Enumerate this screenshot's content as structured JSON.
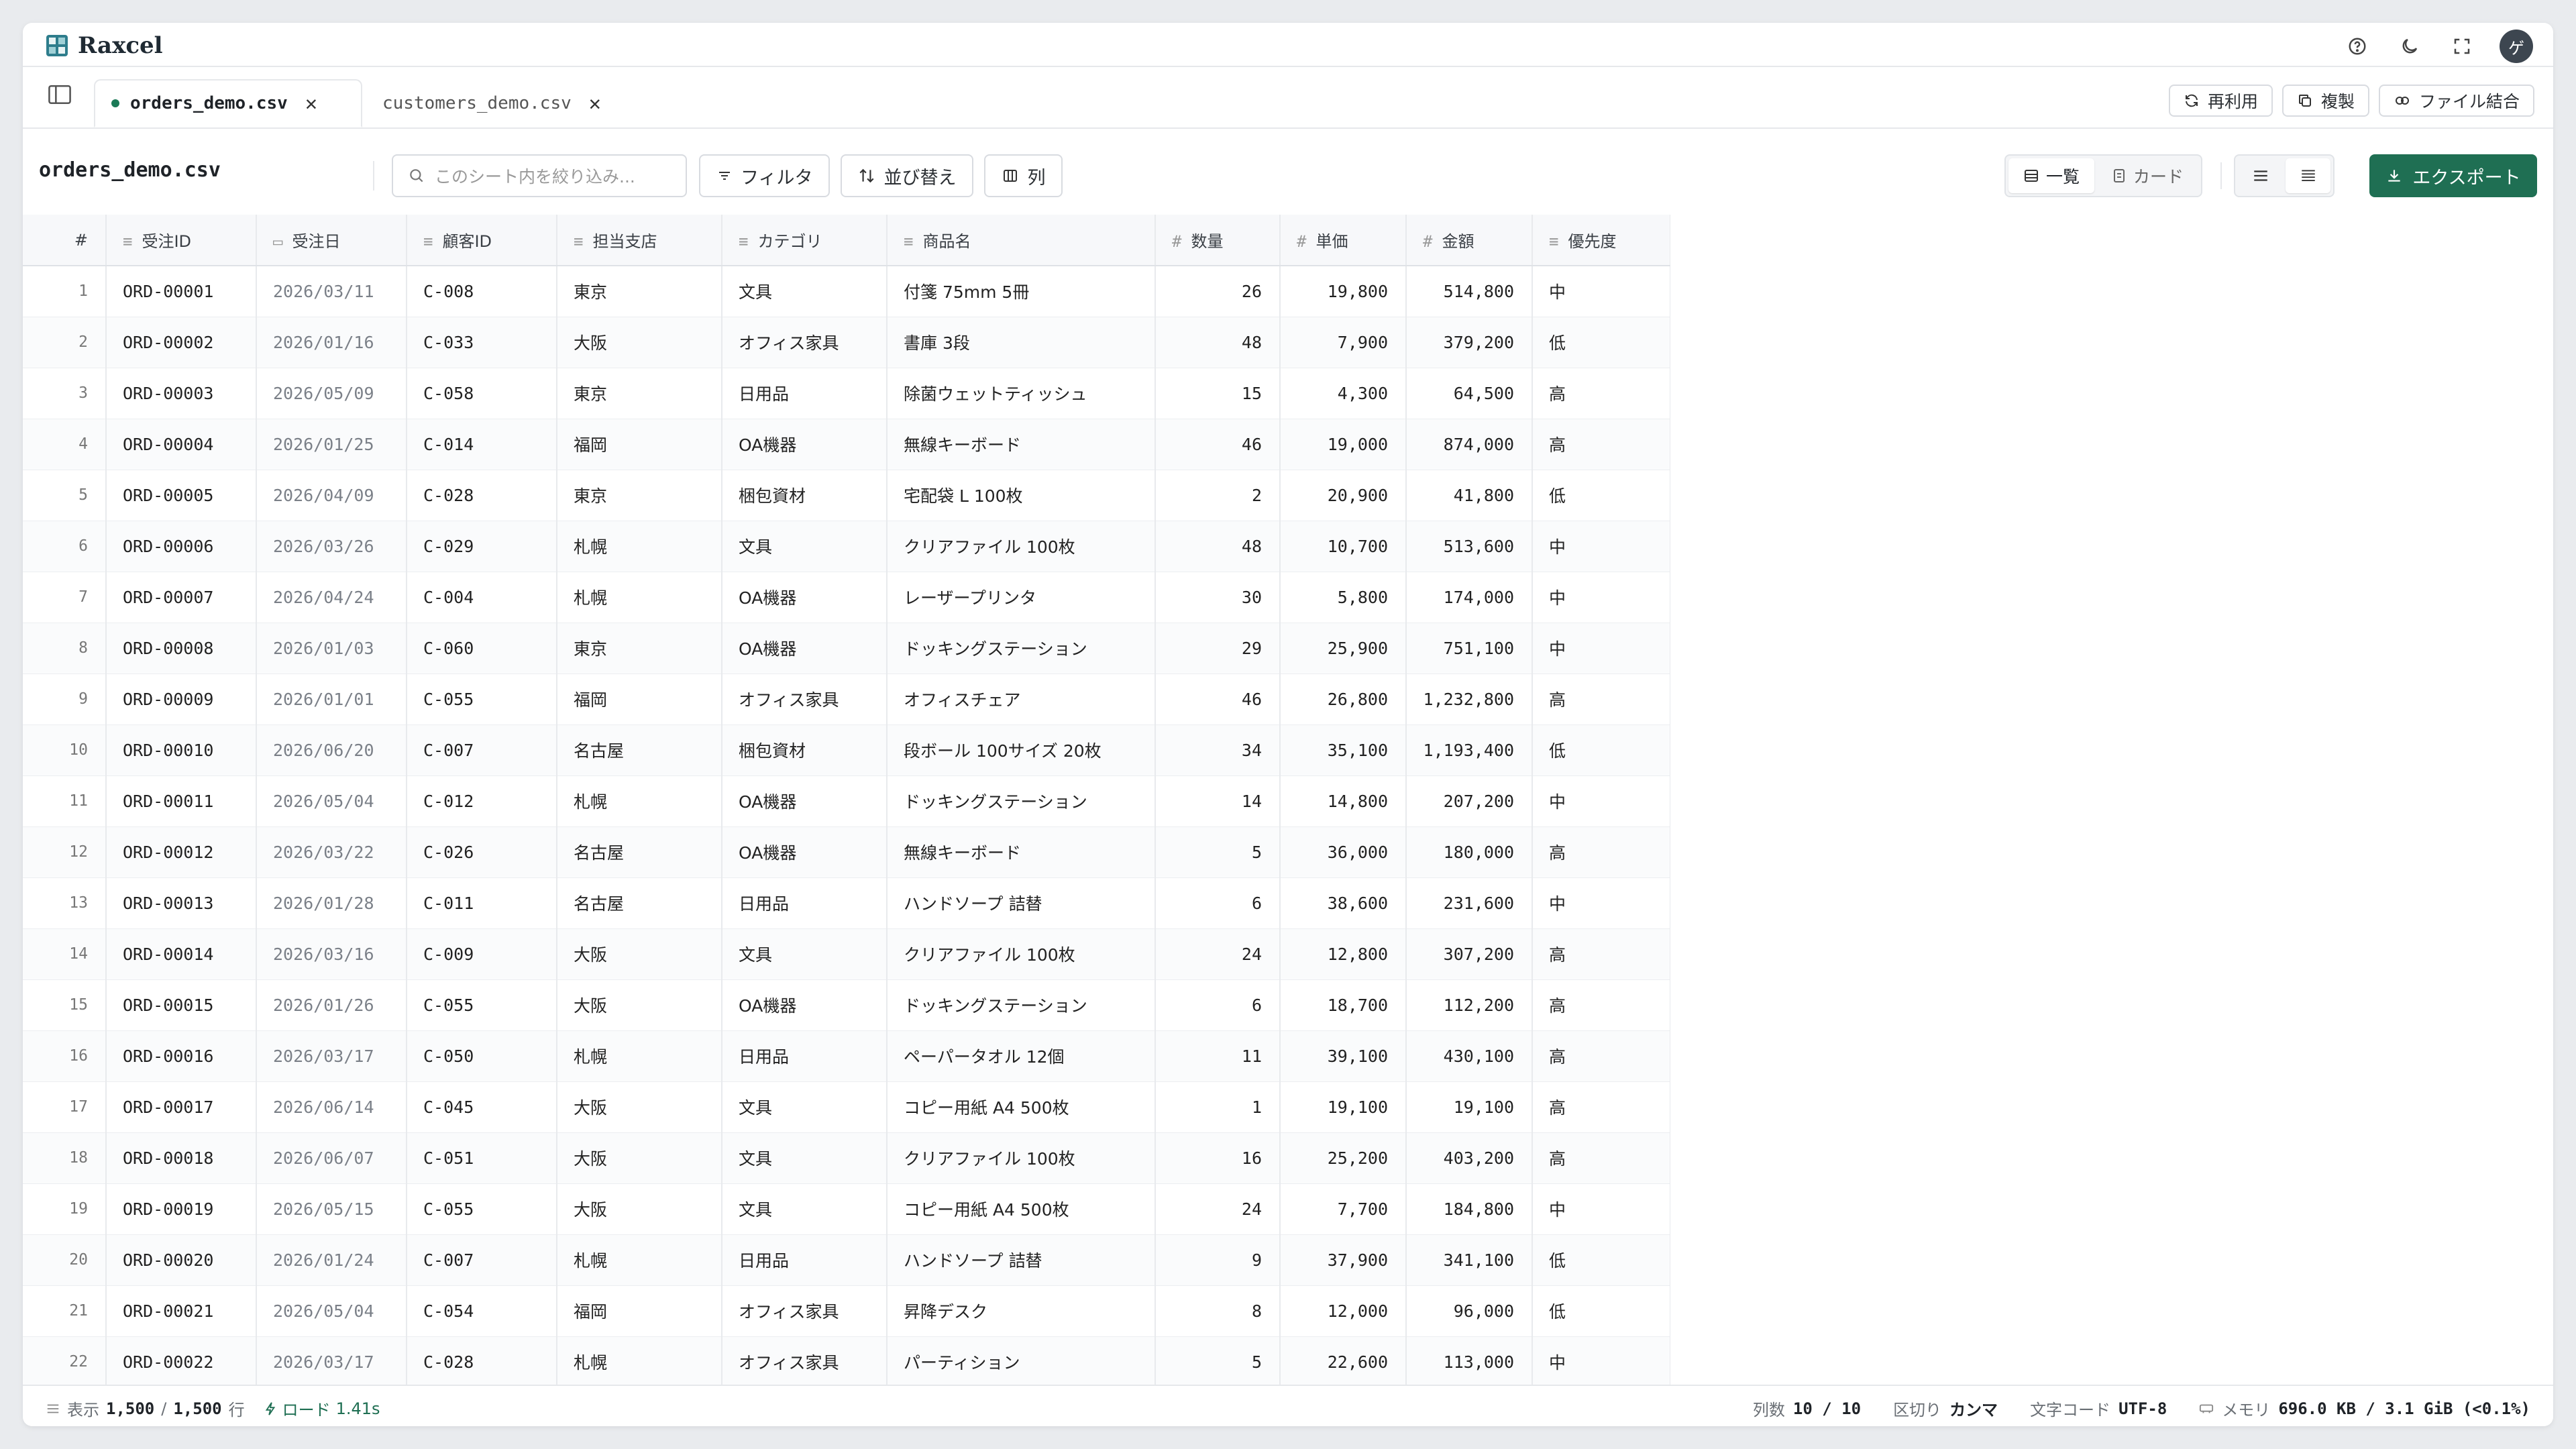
{
  "app": {
    "name": "Raxcel"
  },
  "titlebar_icons": [
    "help-icon",
    "moon-icon",
    "fullscreen-icon"
  ],
  "avatar_initial": "ゲ",
  "tabs": [
    {
      "label": "orders_demo.csv",
      "active": true
    },
    {
      "label": "customers_demo.csv",
      "active": false
    }
  ],
  "tab_actions": {
    "reuse": "再利用",
    "duplicate": "複製",
    "merge": "ファイル結合"
  },
  "toolbar": {
    "file_name": "orders_demo.csv",
    "search_placeholder": "このシート内を絞り込み...",
    "filter_label": "フィルタ",
    "sort_label": "並び替え",
    "columns_label": "列",
    "view_list": "一覧",
    "view_card": "カード",
    "export_label": "エクスポート"
  },
  "accent_color": "#1f6f53",
  "table": {
    "columns": [
      {
        "label": "#",
        "type": "index"
      },
      {
        "label": "受注ID",
        "type": "text"
      },
      {
        "label": "受注日",
        "type": "date"
      },
      {
        "label": "顧客ID",
        "type": "text"
      },
      {
        "label": "担当支店",
        "type": "text"
      },
      {
        "label": "カテゴリ",
        "type": "text"
      },
      {
        "label": "商品名",
        "type": "text"
      },
      {
        "label": "数量",
        "type": "number"
      },
      {
        "label": "単価",
        "type": "number"
      },
      {
        "label": "金額",
        "type": "number"
      },
      {
        "label": "優先度",
        "type": "text"
      }
    ],
    "rows": [
      [
        "1",
        "ORD-00001",
        "2026/03/11",
        "C-008",
        "東京",
        "文具",
        "付箋 75mm 5冊",
        "26",
        "19,800",
        "514,800",
        "中"
      ],
      [
        "2",
        "ORD-00002",
        "2026/01/16",
        "C-033",
        "大阪",
        "オフィス家具",
        "書庫 3段",
        "48",
        "7,900",
        "379,200",
        "低"
      ],
      [
        "3",
        "ORD-00003",
        "2026/05/09",
        "C-058",
        "東京",
        "日用品",
        "除菌ウェットティッシュ",
        "15",
        "4,300",
        "64,500",
        "高"
      ],
      [
        "4",
        "ORD-00004",
        "2026/01/25",
        "C-014",
        "福岡",
        "OA機器",
        "無線キーボード",
        "46",
        "19,000",
        "874,000",
        "高"
      ],
      [
        "5",
        "ORD-00005",
        "2026/04/09",
        "C-028",
        "東京",
        "梱包資材",
        "宅配袋 L 100枚",
        "2",
        "20,900",
        "41,800",
        "低"
      ],
      [
        "6",
        "ORD-00006",
        "2026/03/26",
        "C-029",
        "札幌",
        "文具",
        "クリアファイル 100枚",
        "48",
        "10,700",
        "513,600",
        "中"
      ],
      [
        "7",
        "ORD-00007",
        "2026/04/24",
        "C-004",
        "札幌",
        "OA機器",
        "レーザープリンタ",
        "30",
        "5,800",
        "174,000",
        "中"
      ],
      [
        "8",
        "ORD-00008",
        "2026/01/03",
        "C-060",
        "東京",
        "OA機器",
        "ドッキングステーション",
        "29",
        "25,900",
        "751,100",
        "中"
      ],
      [
        "9",
        "ORD-00009",
        "2026/01/01",
        "C-055",
        "福岡",
        "オフィス家具",
        "オフィスチェア",
        "46",
        "26,800",
        "1,232,800",
        "高"
      ],
      [
        "10",
        "ORD-00010",
        "2026/06/20",
        "C-007",
        "名古屋",
        "梱包資材",
        "段ボール 100サイズ 20枚",
        "34",
        "35,100",
        "1,193,400",
        "低"
      ],
      [
        "11",
        "ORD-00011",
        "2026/05/04",
        "C-012",
        "札幌",
        "OA機器",
        "ドッキングステーション",
        "14",
        "14,800",
        "207,200",
        "中"
      ],
      [
        "12",
        "ORD-00012",
        "2026/03/22",
        "C-026",
        "名古屋",
        "OA機器",
        "無線キーボード",
        "5",
        "36,000",
        "180,000",
        "高"
      ],
      [
        "13",
        "ORD-00013",
        "2026/01/28",
        "C-011",
        "名古屋",
        "日用品",
        "ハンドソープ 詰替",
        "6",
        "38,600",
        "231,600",
        "中"
      ],
      [
        "14",
        "ORD-00014",
        "2026/03/16",
        "C-009",
        "大阪",
        "文具",
        "クリアファイル 100枚",
        "24",
        "12,800",
        "307,200",
        "高"
      ],
      [
        "15",
        "ORD-00015",
        "2026/01/26",
        "C-055",
        "大阪",
        "OA機器",
        "ドッキングステーション",
        "6",
        "18,700",
        "112,200",
        "高"
      ],
      [
        "16",
        "ORD-00016",
        "2026/03/17",
        "C-050",
        "札幌",
        "日用品",
        "ペーパータオル 12個",
        "11",
        "39,100",
        "430,100",
        "高"
      ],
      [
        "17",
        "ORD-00017",
        "2026/06/14",
        "C-045",
        "大阪",
        "文具",
        "コピー用紙 A4 500枚",
        "1",
        "19,100",
        "19,100",
        "高"
      ],
      [
        "18",
        "ORD-00018",
        "2026/06/07",
        "C-051",
        "大阪",
        "文具",
        "クリアファイル 100枚",
        "16",
        "25,200",
        "403,200",
        "高"
      ],
      [
        "19",
        "ORD-00019",
        "2026/05/15",
        "C-055",
        "大阪",
        "文具",
        "コピー用紙 A4 500枚",
        "24",
        "7,700",
        "184,800",
        "中"
      ],
      [
        "20",
        "ORD-00020",
        "2026/01/24",
        "C-007",
        "札幌",
        "日用品",
        "ハンドソープ 詰替",
        "9",
        "37,900",
        "341,100",
        "低"
      ],
      [
        "21",
        "ORD-00021",
        "2026/05/04",
        "C-054",
        "福岡",
        "オフィス家具",
        "昇降デスク",
        "8",
        "12,000",
        "96,000",
        "低"
      ],
      [
        "22",
        "ORD-00022",
        "2026/03/17",
        "C-028",
        "札幌",
        "オフィス家具",
        "パーティション",
        "5",
        "22,600",
        "113,000",
        "中"
      ]
    ]
  },
  "status": {
    "display_label": "表示",
    "display_count": "1,500",
    "slash": "/",
    "total_count": "1,500",
    "rows_unit": "行",
    "load_label": "ロード",
    "load_time": "1.41s",
    "columns_label": "列数",
    "columns_value": "10 / 10",
    "delimiter_label": "区切り",
    "delimiter_value": "カンマ",
    "encoding_label": "文字コード",
    "encoding_value": "UTF-8",
    "memory_label": "メモリ",
    "memory_value": "696.0 KB / 3.1 GiB (<0.1%)"
  }
}
